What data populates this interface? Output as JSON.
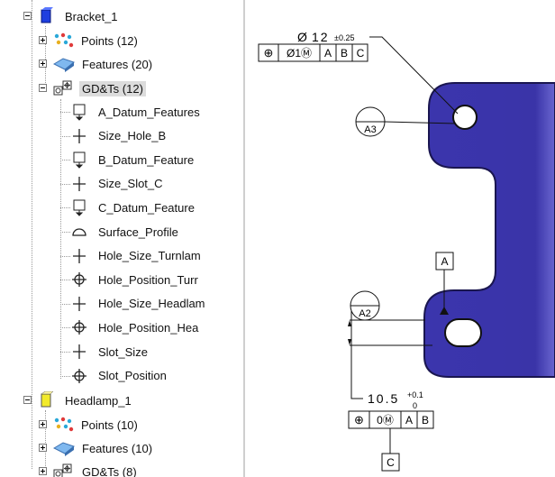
{
  "tree": {
    "bracket": {
      "label": "Bracket_1"
    },
    "bracket_children": [
      {
        "label": "Points (12)"
      },
      {
        "label": "Features (20)"
      },
      {
        "label": "GD&Ts (12)"
      }
    ],
    "gdts": [
      {
        "label": "A_Datum_Features",
        "icon": "datum-icon"
      },
      {
        "label": "Size_Hole_B",
        "icon": "size-icon"
      },
      {
        "label": "B_Datum_Feature",
        "icon": "datum-icon"
      },
      {
        "label": "Size_Slot_C",
        "icon": "size-icon"
      },
      {
        "label": "C_Datum_Feature",
        "icon": "datum-icon"
      },
      {
        "label": "Surface_Profile",
        "icon": "surface-profile-icon"
      },
      {
        "label": "Hole_Size_Turnlam",
        "icon": "size-icon"
      },
      {
        "label": "Hole_Position_Turr",
        "icon": "position-icon"
      },
      {
        "label": "Hole_Size_Headlam",
        "icon": "size-icon"
      },
      {
        "label": "Hole_Position_Hea",
        "icon": "position-icon"
      },
      {
        "label": "Slot_Size",
        "icon": "size-icon"
      },
      {
        "label": "Slot_Position",
        "icon": "position-icon"
      }
    ],
    "headlamp": {
      "label": "Headlamp_1"
    },
    "headlamp_children": [
      {
        "label": "Points (10)"
      },
      {
        "label": "Features (10)"
      },
      {
        "label": "GD&Ts (8)"
      }
    ]
  },
  "drawing": {
    "hole_dim": {
      "symbol": "Ø",
      "value": "12",
      "tol": "±0.25"
    },
    "fcf_top": [
      "⊕",
      "Ø1Ⓜ",
      "A",
      "B",
      "C"
    ],
    "target_a3": "A3",
    "target_a2": "A2",
    "datum_a": "A",
    "datum_c": "C",
    "slot_dim": {
      "value": "10.5",
      "tol_upper": "+0.1",
      "tol_lower": "0"
    },
    "fcf_bottom": [
      "⊕",
      "0Ⓜ",
      "A",
      "B"
    ]
  },
  "colors": {
    "part": "#3a34a8",
    "part_dark": "#24206e",
    "bracket_icon": "#1f3fe0",
    "headlamp_icon": "#f2ea2a"
  }
}
